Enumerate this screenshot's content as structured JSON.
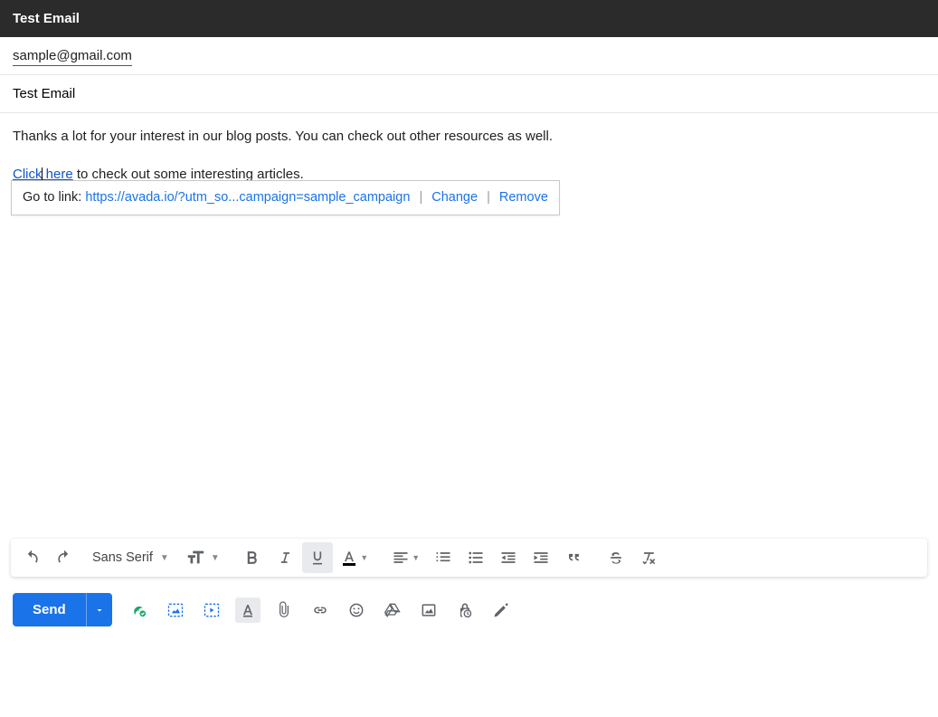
{
  "header": {
    "title": "Test Email"
  },
  "to": {
    "value": "sample@gmail.com"
  },
  "subject": {
    "value": "Test Email"
  },
  "body": {
    "paragraph1": "Thanks a lot for your interest in our blog posts. You can check out other resources as well.",
    "link_text": "Click here",
    "paragraph2_rest": " to check out some interesting articles."
  },
  "link_popover": {
    "prefix": "Go to link: ",
    "url": "https://avada.io/?utm_so...campaign=sample_campaign",
    "change": "Change",
    "remove": "Remove"
  },
  "format_toolbar": {
    "font": "Sans Serif"
  },
  "send": {
    "label": "Send"
  }
}
